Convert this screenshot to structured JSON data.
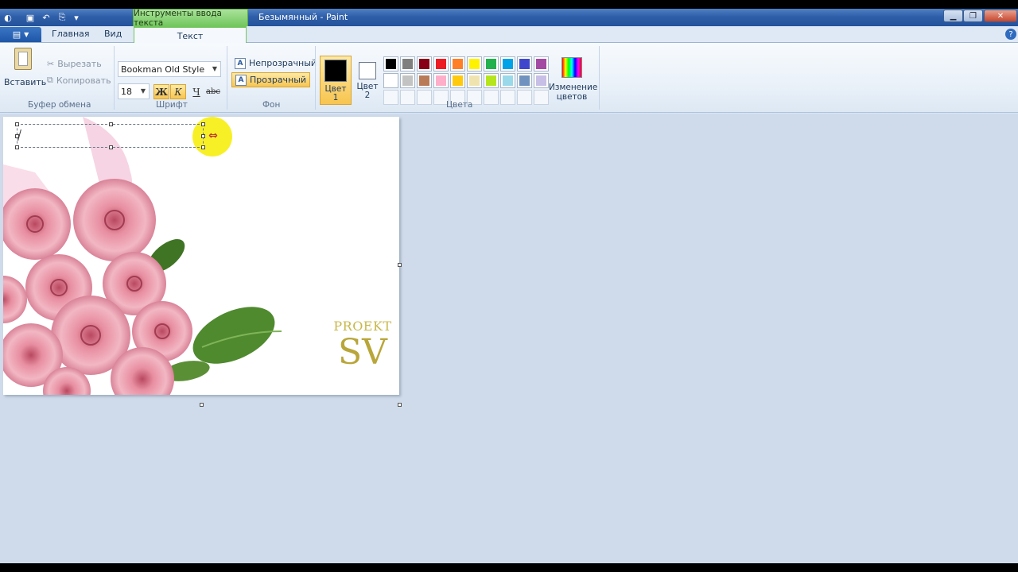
{
  "title_bar": {
    "context_tab_header": "Инструменты ввода текста",
    "window_title": "Безымянный - Paint"
  },
  "tabs": {
    "home": "Главная",
    "view": "Вид",
    "text": "Текст"
  },
  "clipboard": {
    "paste": "Вставить",
    "cut": "Вырезать",
    "copy": "Копировать",
    "group_label": "Буфер обмена"
  },
  "font": {
    "family": "Bookman Old Style",
    "size": "18",
    "bold": "Ж",
    "italic": "К",
    "underline": "Ч",
    "strikethrough": "abc",
    "group_label": "Шрифт"
  },
  "background": {
    "opaque": "Непрозрачный",
    "transparent": "Прозрачный",
    "selected": "transparent",
    "group_label": "Фон"
  },
  "colors": {
    "color1_label": "Цвет 1",
    "color2_label": "Цвет 2",
    "color1": "#000000",
    "color2": "#ffffff",
    "edit_colors": "Изменение цветов",
    "group_label": "Цвета",
    "palette": [
      "#000000",
      "#7f7f7f",
      "#880015",
      "#ed1c24",
      "#ff7f27",
      "#fff200",
      "#22b14c",
      "#00a2e8",
      "#3f48cc",
      "#a349a4",
      "#ffffff",
      "#c3c3c3",
      "#b97a57",
      "#ffaec9",
      "#ffc90e",
      "#efe4b0",
      "#b5e61d",
      "#99d9ea",
      "#7092be",
      "#c8bfe7"
    ]
  },
  "canvas": {
    "logo_text": "PROEKT",
    "logo_mark": "SV"
  }
}
